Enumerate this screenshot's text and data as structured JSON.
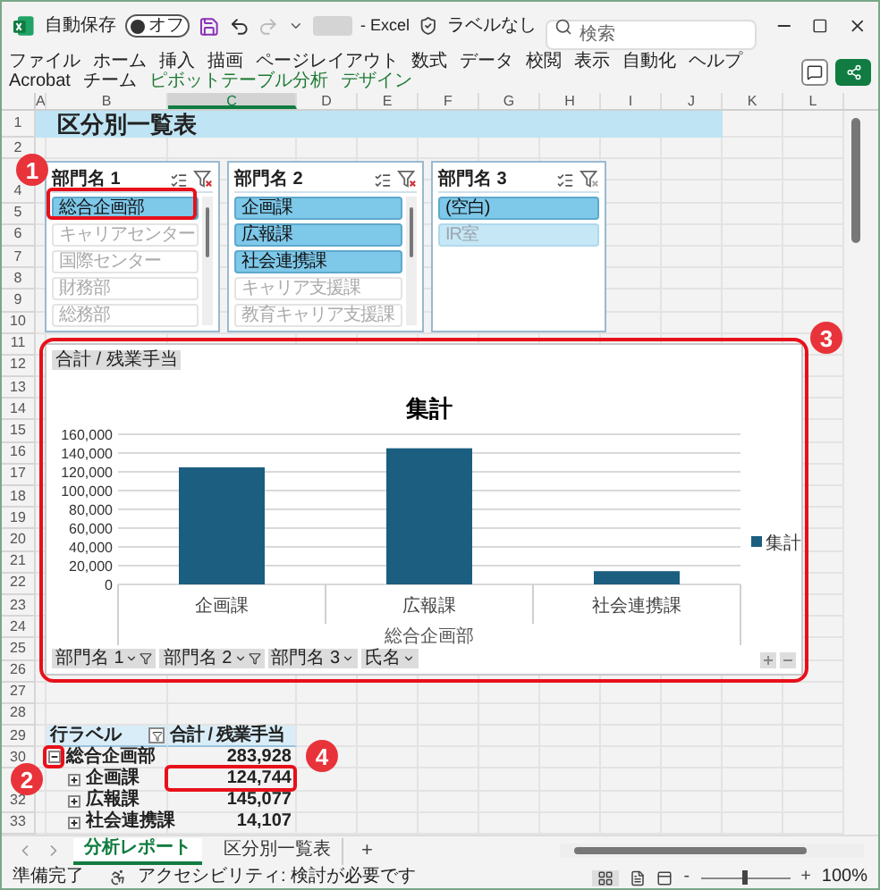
{
  "title_bar": {
    "autosave_label": "自動保存",
    "autosave": {
      "on": false,
      "label": "オフ"
    },
    "app": "- Excel",
    "sensitivity": "ラベルなし",
    "search": {
      "placeholder": "検索"
    }
  },
  "ribbon_tabs": [
    {
      "label": "ファイル",
      "kind": "normal"
    },
    {
      "label": "ホーム",
      "kind": "normal"
    },
    {
      "label": "挿入",
      "kind": "normal"
    },
    {
      "label": "描画",
      "kind": "normal"
    },
    {
      "label": "ページレイアウト",
      "kind": "normal"
    },
    {
      "label": "数式",
      "kind": "normal"
    },
    {
      "label": "データ",
      "kind": "normal"
    },
    {
      "label": "校閲",
      "kind": "normal"
    },
    {
      "label": "表示",
      "kind": "normal"
    },
    {
      "label": "自動化",
      "kind": "normal"
    },
    {
      "label": "ヘルプ",
      "kind": "normal"
    },
    {
      "label": "Acrobat",
      "kind": "normal"
    },
    {
      "label": "チーム",
      "kind": "normal"
    },
    {
      "label": "ピボットテーブル分析",
      "kind": "contextual"
    },
    {
      "label": "デザイン",
      "kind": "contextual"
    }
  ],
  "columns": [
    {
      "label": "A",
      "selected": false
    },
    {
      "label": "B",
      "selected": false
    },
    {
      "label": "C",
      "selected": true
    },
    {
      "label": "D",
      "selected": false
    },
    {
      "label": "E",
      "selected": false
    },
    {
      "label": "F",
      "selected": false
    },
    {
      "label": "G",
      "selected": false
    },
    {
      "label": "H",
      "selected": false
    },
    {
      "label": "I",
      "selected": false
    },
    {
      "label": "J",
      "selected": false
    },
    {
      "label": "K",
      "selected": false
    },
    {
      "label": "L",
      "selected": false
    }
  ],
  "rows": [
    {
      "number": "1"
    },
    {
      "number": "2"
    },
    {},
    {
      "number": "4"
    },
    {
      "number": "5"
    },
    {
      "number": "6"
    },
    {
      "number": "7"
    },
    {
      "number": "8"
    },
    {
      "number": "9"
    },
    {
      "number": "10"
    },
    {
      "number": "11"
    },
    {
      "number": "12"
    },
    {
      "number": "13"
    },
    {
      "number": "14"
    },
    {
      "number": "15"
    },
    {
      "number": "16"
    },
    {
      "number": "17"
    },
    {
      "number": "18"
    },
    {
      "number": "19"
    },
    {
      "number": "20"
    },
    {
      "number": "21"
    },
    {
      "number": "22"
    },
    {
      "number": "23"
    },
    {
      "number": "24"
    },
    {
      "number": "25"
    },
    {
      "number": "26"
    },
    {
      "number": "27"
    },
    {
      "number": "28"
    },
    {
      "number": "29"
    },
    {
      "number": "30"
    },
    {},
    {
      "number": "32"
    },
    {
      "number": "33"
    }
  ],
  "sheet_title": "区分別一覧表",
  "slicers": [
    {
      "title": "部門名 1",
      "filtered": true,
      "scrollbar": true,
      "items": [
        {
          "label": "総合企画部",
          "selected": true,
          "has_data": true
        },
        {
          "label": "キャリアセンター",
          "selected": false,
          "has_data": false
        },
        {
          "label": "国際センター",
          "selected": false,
          "has_data": false
        },
        {
          "label": "財務部",
          "selected": false,
          "has_data": false
        },
        {
          "label": "総務部",
          "selected": false,
          "has_data": false
        }
      ]
    },
    {
      "title": "部門名 2",
      "filtered": true,
      "scrollbar": true,
      "items": [
        {
          "label": "企画課",
          "selected": true,
          "has_data": true
        },
        {
          "label": "広報課",
          "selected": true,
          "has_data": true
        },
        {
          "label": "社会連携課",
          "selected": true,
          "has_data": true
        },
        {
          "label": "キャリア支援課",
          "selected": false,
          "has_data": false
        },
        {
          "label": "教育キャリア支援課",
          "selected": false,
          "has_data": false
        }
      ]
    },
    {
      "title": "部門名 3",
      "filtered": false,
      "scrollbar": false,
      "items": [
        {
          "label": "(空白)",
          "selected": true,
          "has_data": true
        },
        {
          "label": "IR室",
          "selected": true,
          "has_data": false
        }
      ]
    }
  ],
  "chart": {
    "value_field_button": "合計 / 残業手当",
    "field_buttons": [
      {
        "label": "部門名 1",
        "filtered": true
      },
      {
        "label": "部門名 2",
        "filtered": true
      },
      {
        "label": "部門名 3",
        "filtered": false
      },
      {
        "label": "氏名",
        "filtered": false
      }
    ],
    "chart_data": {
      "type": "bar",
      "title": "集計",
      "xlabel": "総合企画部",
      "categories": [
        "企画課",
        "広報課",
        "社会連携課"
      ],
      "series": [
        {
          "name": "集計",
          "color": "#1b5e80",
          "values": [
            124744,
            145077,
            14107
          ]
        }
      ],
      "ylim": [
        0,
        160000
      ],
      "grid": true,
      "yticks": [
        {
          "value": 0,
          "label": "0"
        },
        {
          "value": 20000,
          "label": "20,000"
        },
        {
          "value": 40000,
          "label": "40,000"
        },
        {
          "value": 60000,
          "label": "60,000"
        },
        {
          "value": 80000,
          "label": "80,000"
        },
        {
          "value": 100000,
          "label": "100,000"
        },
        {
          "value": 120000,
          "label": "120,000"
        },
        {
          "value": 140000,
          "label": "140,000"
        },
        {
          "value": 160000,
          "label": "160,000"
        }
      ]
    }
  },
  "pivot": {
    "row_label": "行ラベル",
    "value_header": "合計 / 残業手当",
    "rows": [
      {
        "label": "総合企画部",
        "value": "283,928",
        "expanded": true,
        "children": [
          {
            "label": "企画課",
            "value": "124,744",
            "expanded": false
          },
          {
            "label": "広報課",
            "value": "145,077",
            "expanded": false
          },
          {
            "label": "社会連携課",
            "value": "14,107",
            "expanded": false
          }
        ]
      }
    ]
  },
  "callouts": [
    {
      "label": "1"
    },
    {
      "label": "2"
    },
    {
      "label": "3"
    },
    {
      "label": "4"
    }
  ],
  "sheet_tabs": [
    {
      "label": "分析レポート",
      "selected": true
    },
    {
      "label": "区分別一覧表",
      "selected": false
    }
  ],
  "add_sheet": "+",
  "status_bar": {
    "ready": "準備完了",
    "accessibility": "アクセシビリティ: 検討が必要です",
    "zoom_out": "-",
    "zoom_slider": {
      "level": 0.5
    },
    "zoom_in": "+",
    "zoom": "100%"
  }
}
